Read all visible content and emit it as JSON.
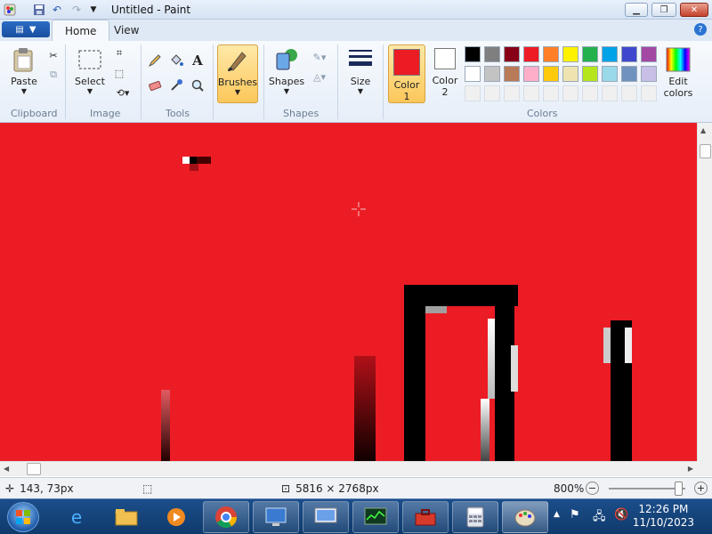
{
  "window": {
    "title": "Untitled - Paint"
  },
  "tabs": [
    {
      "label": "Home",
      "active": true
    },
    {
      "label": "View",
      "active": false
    }
  ],
  "ribbon": {
    "clipboard": {
      "paste": "Paste",
      "group": "Clipboard"
    },
    "image": {
      "select": "Select",
      "group": "Image"
    },
    "tools": {
      "group": "Tools"
    },
    "brushes": {
      "label": "Brushes"
    },
    "shapes": {
      "label": "Shapes",
      "group": "Shapes"
    },
    "size": {
      "label": "Size"
    },
    "colors": {
      "color1_line1": "Color",
      "color1_line2": "1",
      "color2_line1": "Color",
      "color2_line2": "2",
      "edit_line1": "Edit",
      "edit_line2": "colors",
      "group": "Colors",
      "color1_value": "#ec1c24",
      "color2_value": "#ffffff",
      "palette_row1": [
        "#000000",
        "#7f7f7f",
        "#880015",
        "#ed1c24",
        "#ff7f27",
        "#fff200",
        "#22b14c",
        "#00a2e8",
        "#3f48cc",
        "#a349a4"
      ],
      "palette_row2": [
        "#ffffff",
        "#c3c3c3",
        "#b97a57",
        "#ffaec9",
        "#ffc90e",
        "#efe4b0",
        "#b5e61d",
        "#99d9ea",
        "#7092be",
        "#c8bfe7"
      ]
    }
  },
  "canvas": {
    "background": "#ec1c24"
  },
  "status": {
    "cursor_pos": "143, 73px",
    "image_size": "5816 × 2768px",
    "zoom": "800%"
  },
  "taskbar": {
    "time": "12:26 PM",
    "date": "11/10/2023"
  }
}
